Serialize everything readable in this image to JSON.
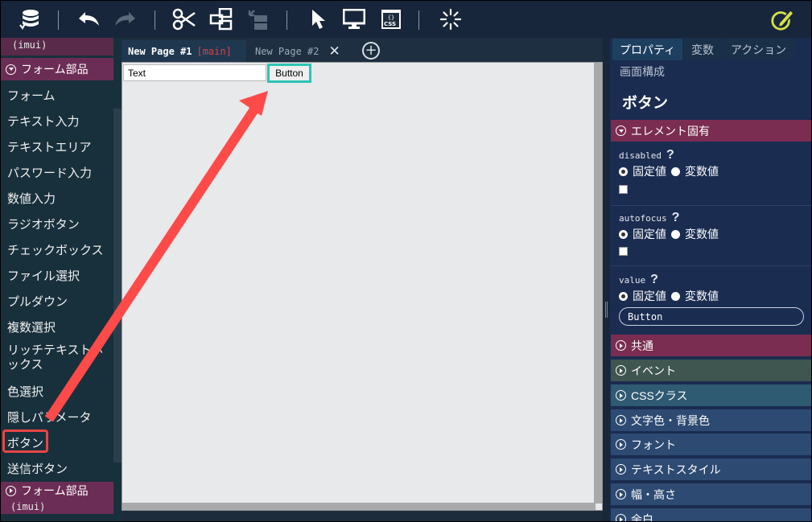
{
  "toolbar": {
    "icons": [
      "database-icon",
      "undo-icon",
      "redo-icon",
      "scissors-icon",
      "hierarchy-icon",
      "move-down-icon",
      "cursor-icon",
      "monitor-icon",
      "css-icon",
      "loading-icon",
      "edit-icon"
    ],
    "css_label": "CSS"
  },
  "sidebar": {
    "top_sub": "(imui)",
    "category_open": "フォーム部品",
    "items": [
      "フォーム",
      "テキスト入力",
      "テキストエリア",
      "パスワード入力",
      "数値入力",
      "ラジオボタン",
      "チェックボックス",
      "ファイル選択",
      "プルダウン",
      "複数選択",
      "リッチテキストボックス",
      "色選択",
      "隠しパラメータ",
      "ボタン",
      "送信ボタン"
    ],
    "category_closed": "フォーム部品",
    "category_closed_sub": "(imui)"
  },
  "tabs": [
    {
      "label": "New Page #1",
      "tag": "[main]"
    },
    {
      "label": "New Page #2"
    }
  ],
  "canvas": {
    "text_value": "Text",
    "button_label": "Button"
  },
  "panel": {
    "tabs": [
      "プロパティ",
      "変数",
      "アクション",
      "画面構成"
    ],
    "title": "ボタン",
    "section_specific": "エレメント固有",
    "props": [
      {
        "name": "disabled",
        "fixed": "固定値",
        "variable": "変数値"
      },
      {
        "name": "autofocus",
        "fixed": "固定値",
        "variable": "変数値"
      },
      {
        "name": "value",
        "fixed": "固定値",
        "variable": "変数値",
        "input": "Button"
      }
    ],
    "help": "?",
    "sections": [
      {
        "label": "共通",
        "color": "#7a2d50"
      },
      {
        "label": "イベント",
        "color": "#3f5550"
      },
      {
        "label": "CSSクラス",
        "color": "#2e5a72"
      },
      {
        "label": "文字色・背景色",
        "color": "#2d4a72"
      },
      {
        "label": "フォント",
        "color": "#2d4a72"
      },
      {
        "label": "テキストスタイル",
        "color": "#2d4a72"
      },
      {
        "label": "幅・高さ",
        "color": "#2d4a72"
      },
      {
        "label": "余白",
        "color": "#2d4a72"
      }
    ]
  },
  "colors": {
    "accent_teal": "#2ec4b6",
    "highlight_red": "#e84545",
    "category_pink": "#6b2d55"
  }
}
